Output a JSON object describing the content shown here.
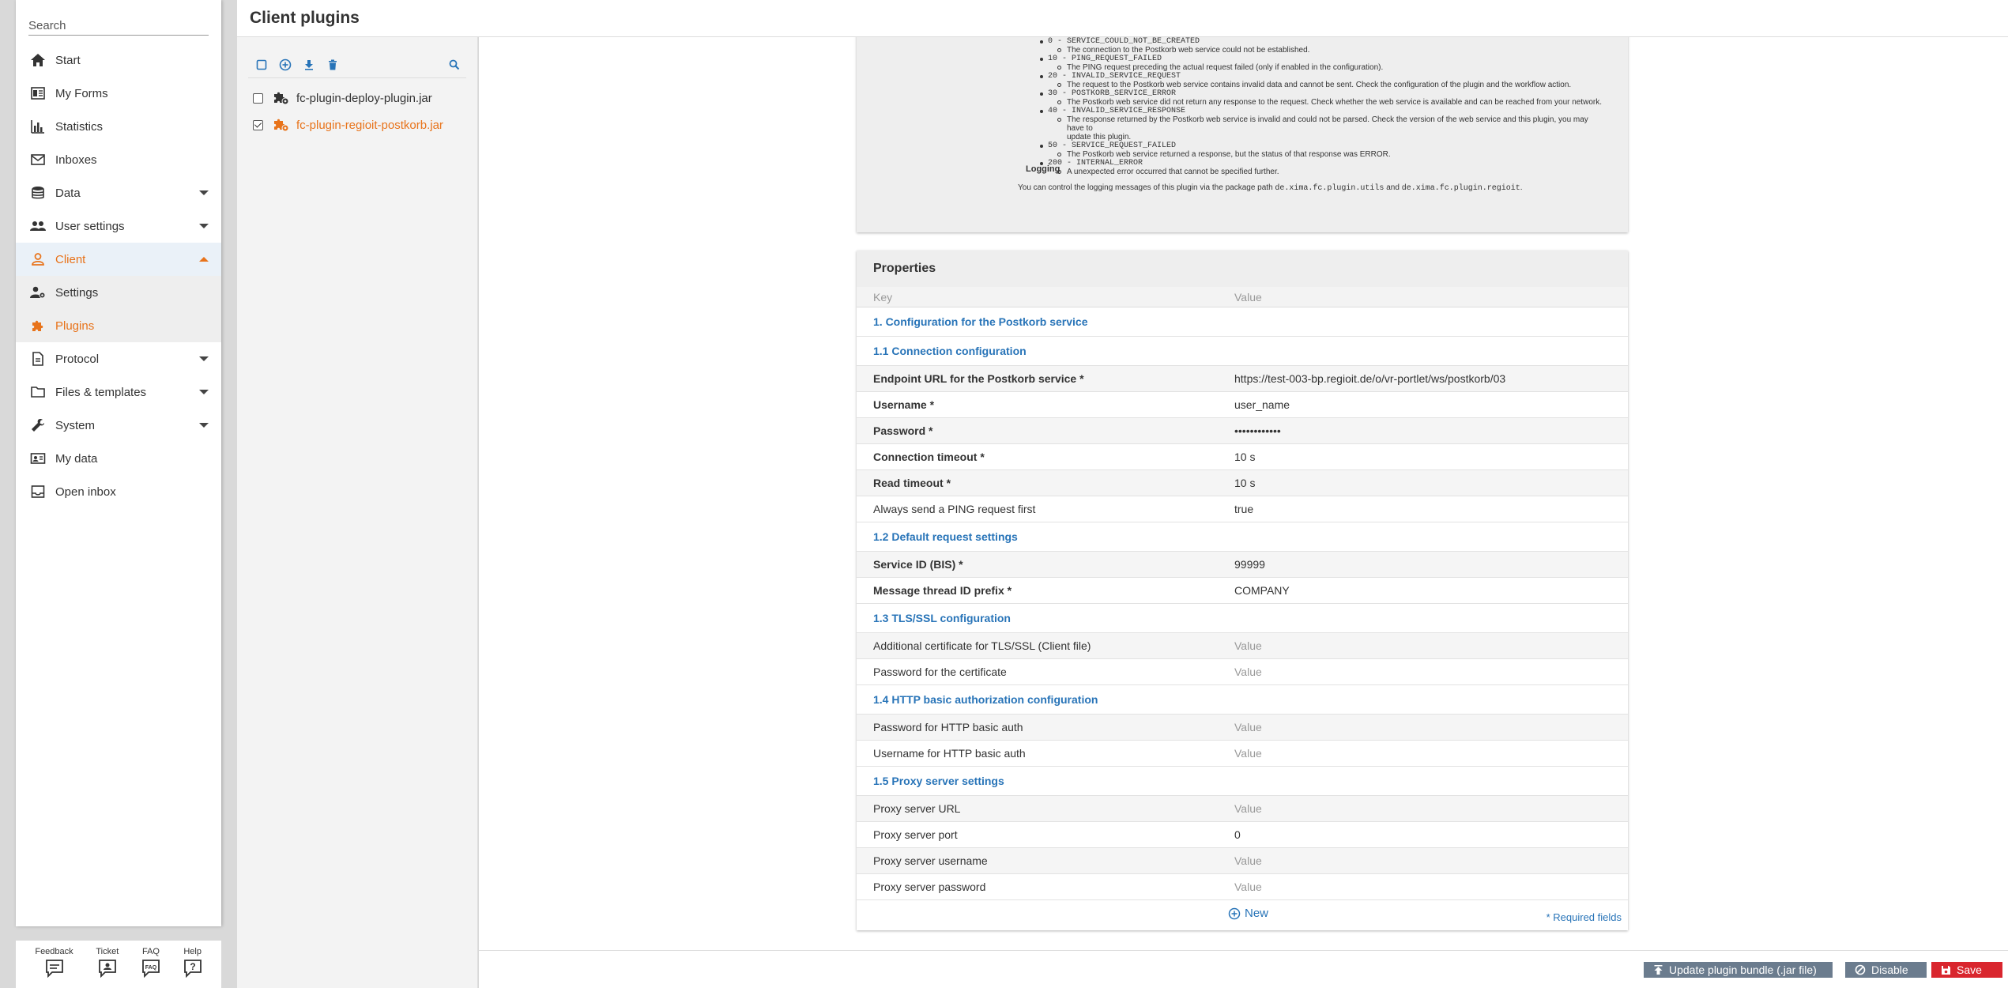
{
  "nav": {
    "search_placeholder": "Search",
    "items": [
      {
        "label": "Start",
        "icon": "home-icon"
      },
      {
        "label": "My Forms",
        "icon": "forms-icon"
      },
      {
        "label": "Statistics",
        "icon": "statistics-icon"
      },
      {
        "label": "Inboxes",
        "icon": "mail-icon"
      },
      {
        "label": "Data",
        "icon": "database-icon"
      },
      {
        "label": "User settings",
        "icon": "users-icon"
      },
      {
        "label": "Client",
        "icon": "person-icon"
      },
      {
        "label": "Settings",
        "icon": "user-gear-icon"
      },
      {
        "label": "Plugins",
        "icon": "puzzle-icon"
      },
      {
        "label": "Protocol",
        "icon": "document-icon"
      },
      {
        "label": "Files & templates",
        "icon": "folder-icon"
      },
      {
        "label": "System",
        "icon": "wrench-icon"
      },
      {
        "label": "My data",
        "icon": "id-card-icon"
      },
      {
        "label": "Open inbox",
        "icon": "inbox-icon"
      }
    ],
    "bottom": [
      {
        "label": "Feedback"
      },
      {
        "label": "Ticket"
      },
      {
        "label": "FAQ",
        "icon_text": "FAQ"
      },
      {
        "label": "Help",
        "icon_text": "?"
      }
    ]
  },
  "header": {
    "title": "Client plugins"
  },
  "plugin_list": {
    "items": [
      {
        "label": "fc-plugin-deploy-plugin.jar",
        "checked": false
      },
      {
        "label": "fc-plugin-regioit-postkorb.jar",
        "checked": true
      }
    ]
  },
  "description": {
    "errors": [
      {
        "code": "0 - SERVICE_COULD_NOT_BE_CREATED",
        "text": "The connection to the Postkorb web service could not be established."
      },
      {
        "code": "10 - PING_REQUEST_FAILED",
        "text": "The PING request preceding the actual request failed (only if enabled in the configuration)."
      },
      {
        "code": "20 - INVALID_SERVICE_REQUEST",
        "text": "The request to the Postkorb web service contains invalid data and cannot be sent. Check the configuration of the plugin and the workflow action."
      },
      {
        "code": "30 - POSTKORB_SERVICE_ERROR",
        "text": "The Postkorb web service did not return any response to the request. Check whether the web service is available and can be reached from your network."
      },
      {
        "code": "40 - INVALID_SERVICE_RESPONSE",
        "text": "The response returned by the Postkorb web service is invalid and could not be parsed. Check the version of the web service and this plugin, you may have to",
        "text2": "update this plugin."
      },
      {
        "code": "50 - SERVICE_REQUEST_FAILED",
        "text": "The Postkorb web service returned a response, but the status of that response was ERROR."
      },
      {
        "code": "200 - INTERNAL_ERROR",
        "text": "A unexpected error occurred that cannot be specified further."
      }
    ],
    "logging_title": "Logging",
    "logging_pre": "You can control the logging messages of this plugin via the package path ",
    "logging_pkg1": "de.xima.fc.plugin.utils",
    "logging_and": " and ",
    "logging_pkg2": "de.xima.fc.plugin.regioit",
    "logging_end": "."
  },
  "properties": {
    "title": "Properties",
    "col_key": "Key",
    "col_value": "Value",
    "rows": [
      {
        "type": "section",
        "label": "1. Configuration for the Postkorb service"
      },
      {
        "type": "section",
        "label": "1.1 Connection configuration"
      },
      {
        "key": "Endpoint URL for the Postkorb service *",
        "value": "https://test-003-bp.regioit.de/o/vr-portlet/ws/postkorb/03"
      },
      {
        "key": "Username *",
        "value": "user_name"
      },
      {
        "key": "Password *",
        "value": "••••••••••••"
      },
      {
        "key": "Connection timeout *",
        "value": "10 s"
      },
      {
        "key": "Read timeout *",
        "value": "10 s"
      },
      {
        "key": "Always send a PING request first",
        "value": "true"
      },
      {
        "type": "section",
        "label": "1.2 Default request settings"
      },
      {
        "key": "Service ID (BIS) *",
        "value": "99999"
      },
      {
        "key": "Message thread ID prefix *",
        "value": "COMPANY"
      },
      {
        "type": "section",
        "label": "1.3 TLS/SSL configuration"
      },
      {
        "key": "Additional certificate for TLS/SSL (Client file)",
        "value": "Value",
        "placeholder": true
      },
      {
        "key": "Password for the certificate",
        "value": "Value",
        "placeholder": true
      },
      {
        "type": "section",
        "label": "1.4 HTTP basic authorization configuration"
      },
      {
        "key": "Password for HTTP basic auth",
        "value": "Value",
        "placeholder": true
      },
      {
        "key": "Username for HTTP basic auth",
        "value": "Value",
        "placeholder": true
      },
      {
        "type": "section",
        "label": "1.5 Proxy server settings"
      },
      {
        "key": "Proxy server URL",
        "value": "Value",
        "placeholder": true
      },
      {
        "key": "Proxy server port",
        "value": "0"
      },
      {
        "key": "Proxy server username",
        "value": "Value",
        "placeholder": true
      },
      {
        "key": "Proxy server password",
        "value": "Value",
        "placeholder": true
      }
    ],
    "new_label": "New",
    "required_note": "* Required fields"
  },
  "actions": {
    "update_label": "Update plugin bundle (.jar file)",
    "disable_label": "Disable",
    "save_label": "Save"
  },
  "colors": {
    "accent_orange": "#e8731a",
    "link_blue": "#2874b8",
    "button_gray": "#6b7c8e",
    "save_red": "#d9262e"
  }
}
